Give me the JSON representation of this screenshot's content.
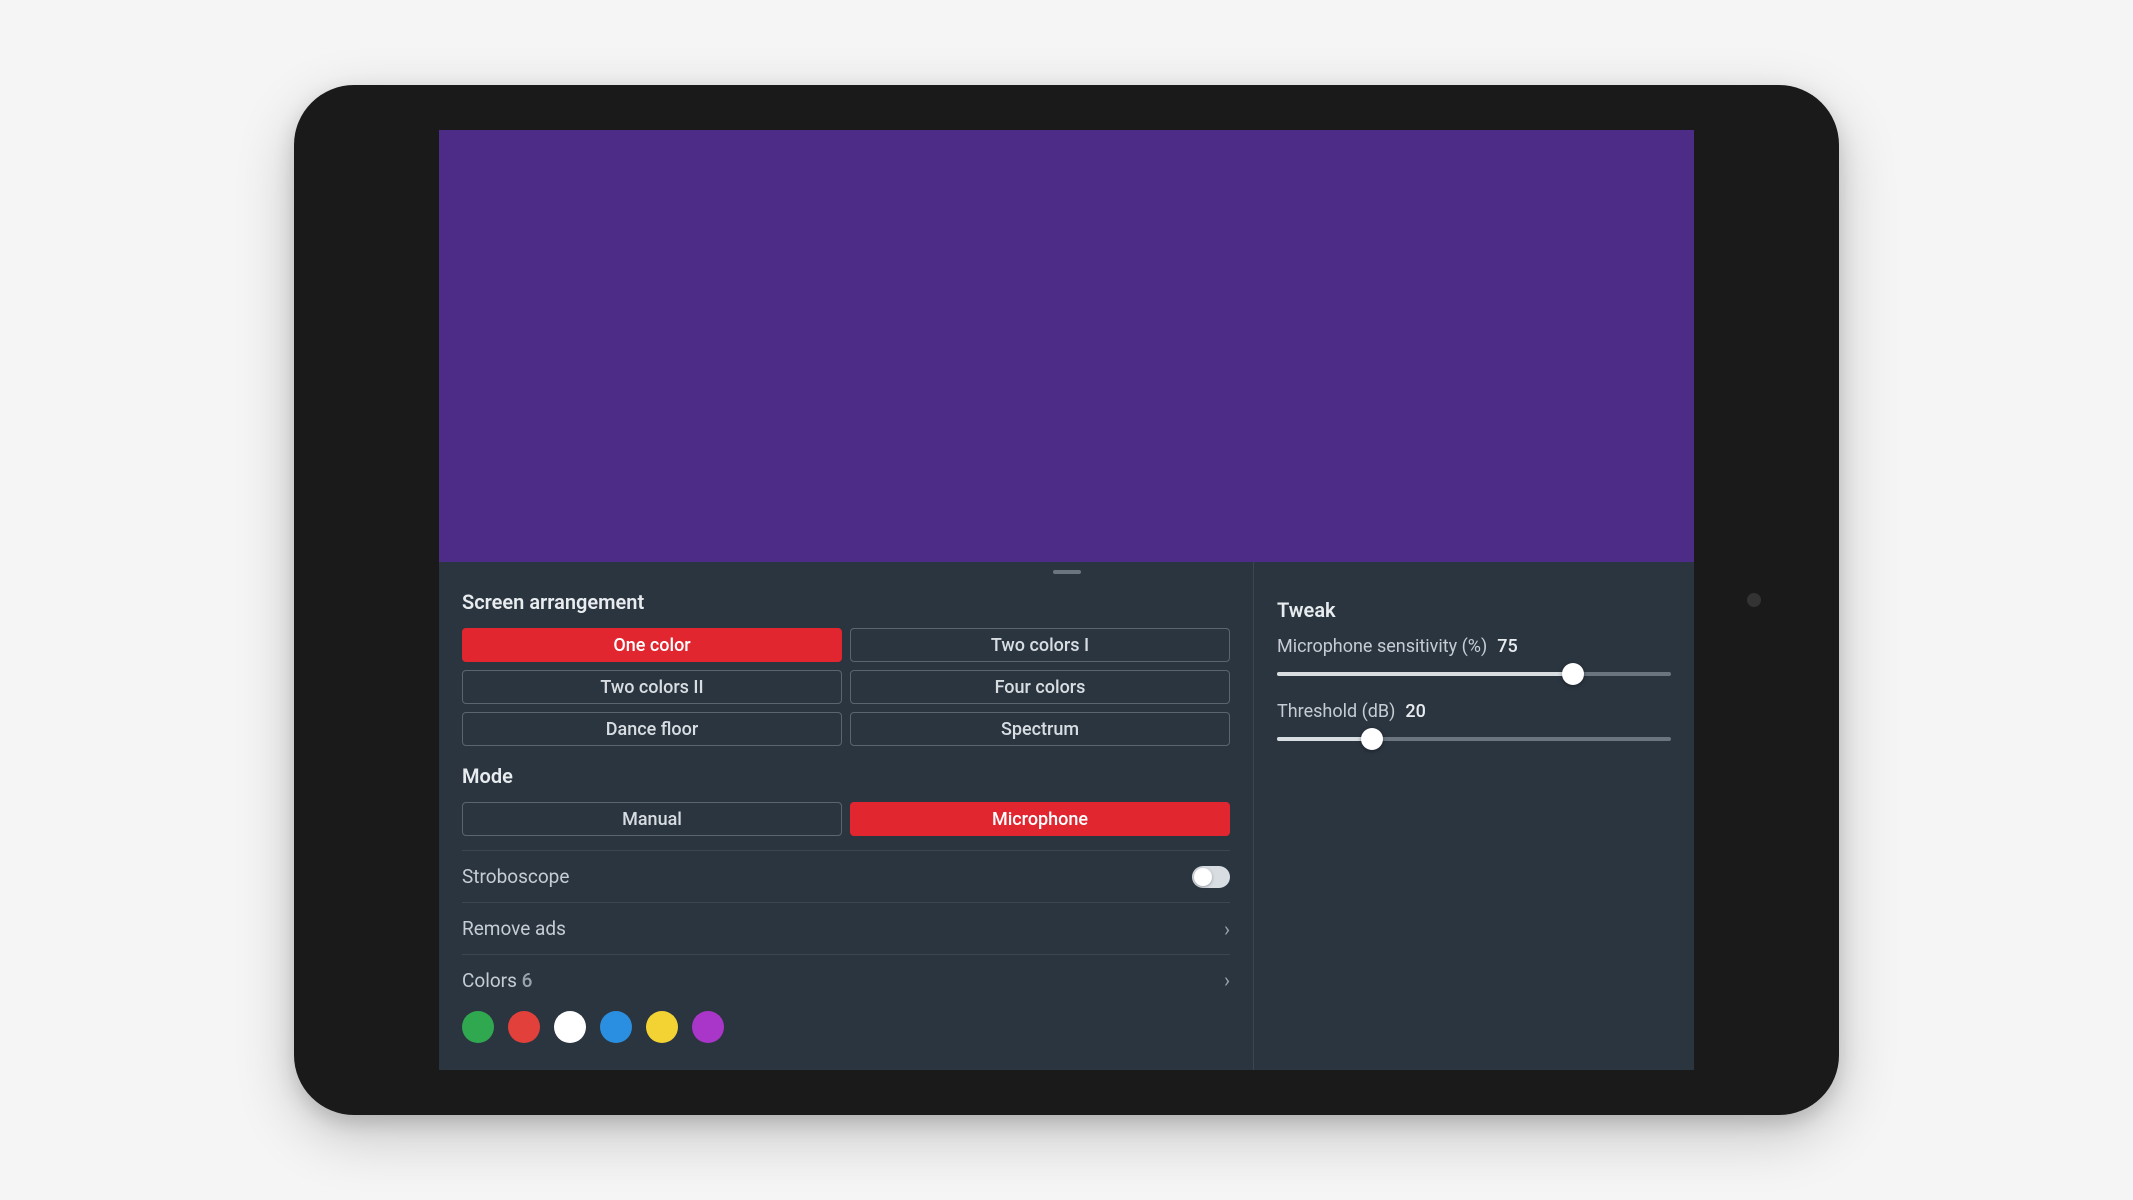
{
  "preview_color": "#4d2c87",
  "screen_arrangement": {
    "title": "Screen arrangement",
    "options": [
      "One color",
      "Two colors I",
      "Two colors II",
      "Four colors",
      "Dance floor",
      "Spectrum"
    ],
    "active": 0
  },
  "mode": {
    "title": "Mode",
    "options": [
      "Manual",
      "Microphone"
    ],
    "active": 1
  },
  "rows": {
    "stroboscope": "Stroboscope",
    "stroboscope_on": false,
    "remove_ads": "Remove ads",
    "colors_label": "Colors",
    "colors_count": "6"
  },
  "colors": [
    "#2fa84f",
    "#e2403a",
    "#ffffff",
    "#2a8fe0",
    "#f2d333",
    "#a936c9"
  ],
  "tweak": {
    "title": "Tweak",
    "mic_label": "Microphone sensitivity (%)",
    "mic_value": "75",
    "mic_pct": 75,
    "thresh_label": "Threshold (dB)",
    "thresh_value": "20",
    "thresh_pct": 24
  }
}
